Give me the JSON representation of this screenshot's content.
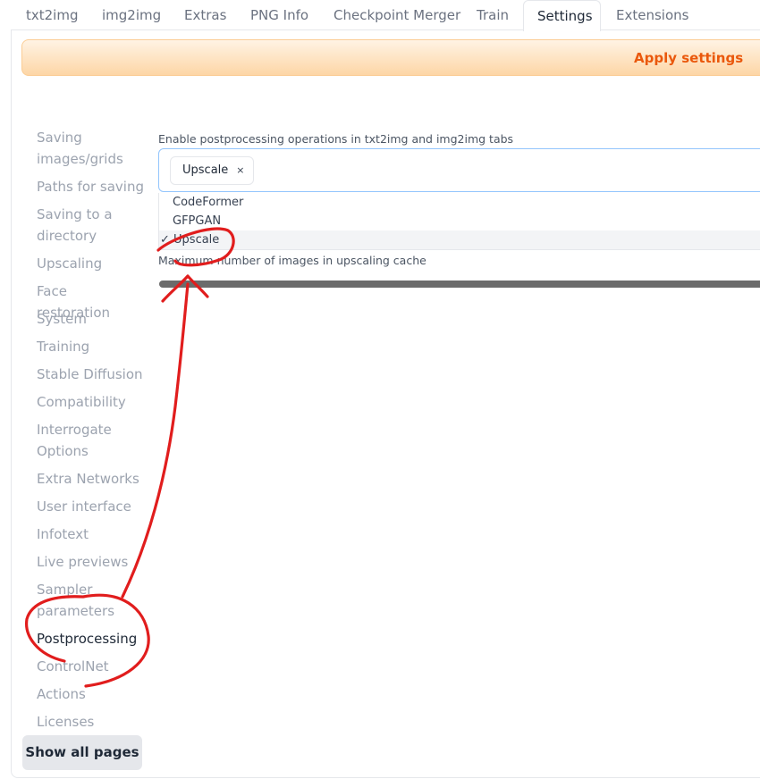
{
  "tabs": [
    {
      "label": "txt2img"
    },
    {
      "label": "img2img"
    },
    {
      "label": "Extras"
    },
    {
      "label": "PNG Info"
    },
    {
      "label": "Checkpoint Merger"
    },
    {
      "label": "Train"
    },
    {
      "label": "Settings"
    },
    {
      "label": "Extensions"
    }
  ],
  "apply_button": "Apply settings",
  "sidebar": {
    "items": [
      {
        "label": "Saving images/grids"
      },
      {
        "label": "Paths for saving"
      },
      {
        "label": "Saving to a directory"
      },
      {
        "label": "Upscaling"
      },
      {
        "label": "Face restoration"
      },
      {
        "label": "System"
      },
      {
        "label": "Training"
      },
      {
        "label": "Stable Diffusion"
      },
      {
        "label": "Compatibility"
      },
      {
        "label": "Interrogate Options"
      },
      {
        "label": "Extra Networks"
      },
      {
        "label": "User interface"
      },
      {
        "label": "Infotext"
      },
      {
        "label": "Live previews"
      },
      {
        "label": "Sampler parameters"
      },
      {
        "label": "Postprocessing"
      },
      {
        "label": "ControlNet"
      },
      {
        "label": "Actions"
      },
      {
        "label": "Licenses"
      }
    ],
    "show_all": "Show all pages"
  },
  "postprocessing": {
    "ops_label": "Enable postprocessing operations in txt2img and img2img tabs",
    "selected_token": "Upscale",
    "token_remove": "×",
    "options": [
      {
        "label": "CodeFormer"
      },
      {
        "label": "GFPGAN"
      },
      {
        "label": "✓ Upscale"
      }
    ],
    "cache_label": "Maximum number of images in upscaling cache"
  },
  "colors": {
    "accent": "#ea580c",
    "annotation": "#e11d1d"
  }
}
